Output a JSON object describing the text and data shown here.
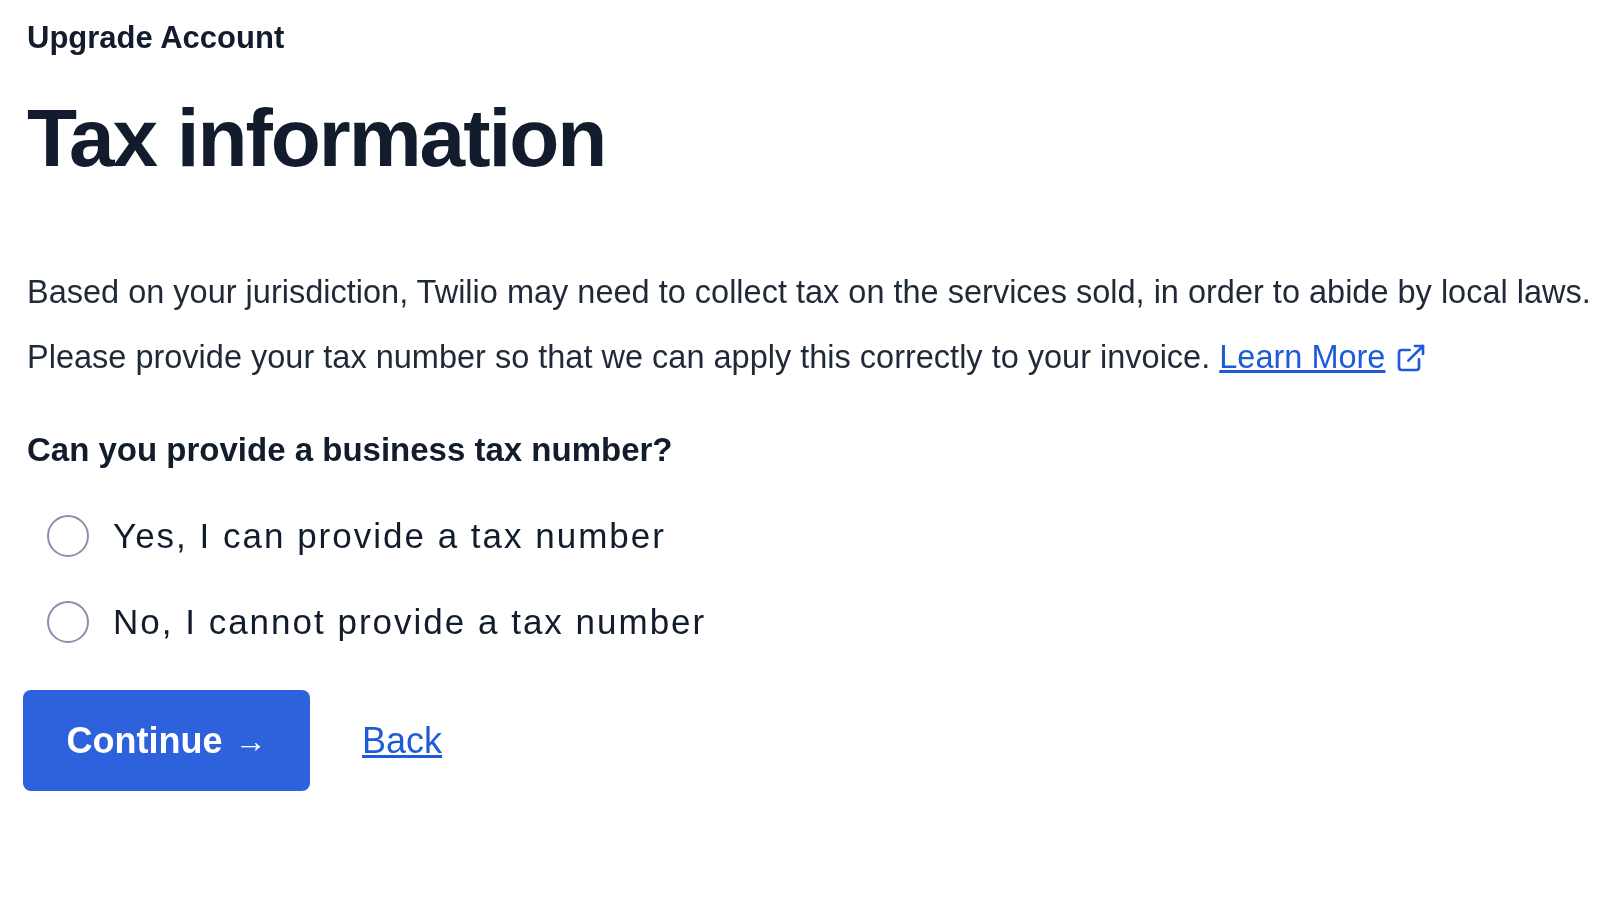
{
  "header": {
    "title": "Upgrade Account"
  },
  "heading": "Tax information",
  "description": {
    "text": "Based on your jurisdiction, Twilio may need to collect tax on the services sold, in order to abide by local laws. Please provide your tax number so that we can apply this correctly to your invoice.",
    "link": "Learn More"
  },
  "question": {
    "label": "Can you provide a business tax number?",
    "options": [
      {
        "label": "Yes, I can provide a tax number",
        "selected": false
      },
      {
        "label": "No, I cannot provide a tax number",
        "selected": false
      }
    ]
  },
  "buttons": {
    "continue": "Continue",
    "arrow": "→",
    "back": "Back"
  }
}
